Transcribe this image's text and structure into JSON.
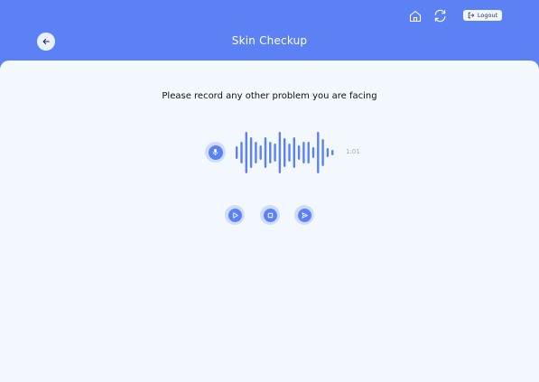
{
  "header": {
    "title": "Skin Checkup",
    "logout_label": "Logout",
    "icons": {
      "home": "home-icon",
      "refresh": "refresh-icon",
      "logout": "logout-icon",
      "back": "arrow-left-icon"
    }
  },
  "recorder": {
    "prompt": "Please record any other problem you are facing",
    "duration": "1:01",
    "mic_icon": "microphone-icon",
    "controls": [
      {
        "name": "play",
        "icon": "play-icon"
      },
      {
        "name": "stop",
        "icon": "stop-icon"
      },
      {
        "name": "send",
        "icon": "send-icon"
      }
    ]
  },
  "colors": {
    "accent": "#5b81f5",
    "panel_background": "#f2f8fe",
    "icon_halo": "#cfdcfb"
  }
}
